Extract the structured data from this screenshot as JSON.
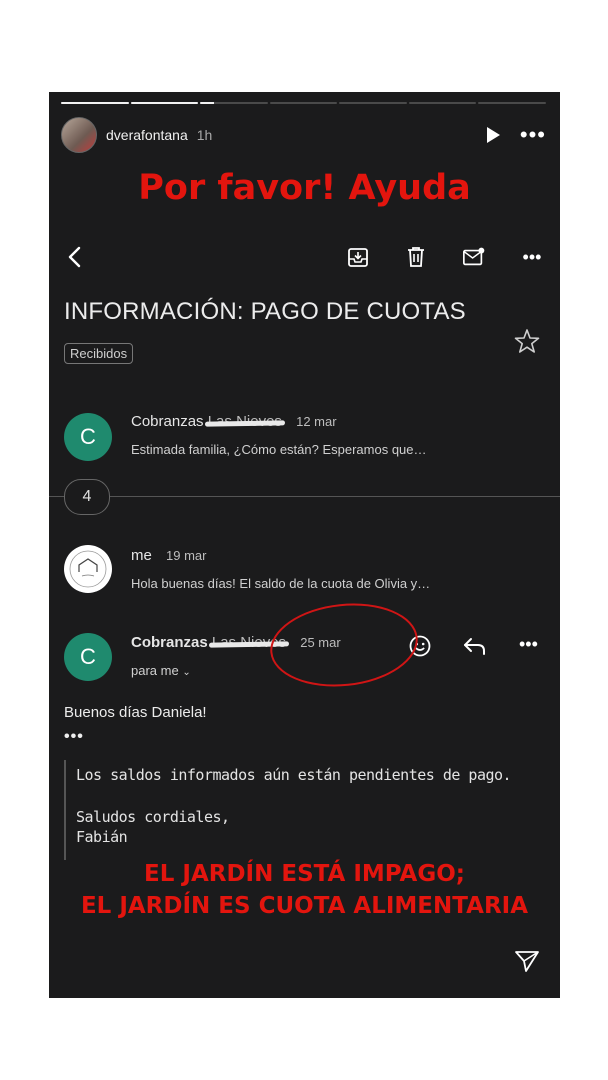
{
  "story": {
    "progress": [
      1.0,
      1.0,
      0.2,
      0,
      0,
      0,
      0
    ],
    "username": "dverafontana",
    "time": "1h",
    "overlay_title": "Por favor! Ayuda",
    "overlay_line1": "EL JARDÍN ESTÁ IMPAGO;",
    "overlay_line2": "EL JARDÍN ES CUOTA ALIMENTARIA"
  },
  "email": {
    "subject": "INFORMACIÓN: PAGO DE CUOTAS",
    "label": "Recibidos",
    "collapsed_count": "4",
    "messages": [
      {
        "avatar": "C",
        "sender": "Cobranzas",
        "scribbled": "Las Nieves",
        "date": "12 mar",
        "snippet": "Estimada familia, ¿Cómo están? Esperamos que…"
      },
      {
        "avatar": "",
        "sender": "me",
        "date": "19 mar",
        "snippet": "Hola buenas días! El saldo de la cuota de Olivia y…"
      },
      {
        "avatar": "C",
        "sender": "Cobranzas",
        "scribbled": "Las Nieves",
        "date": "25 mar",
        "recipient": "para me"
      }
    ],
    "greeting": "Buenos días Daniela!",
    "ellipsis": "•••",
    "quote_line1": "Los saldos informados aún están pendientes de pago.",
    "quote_line2": "Saludos cordiales,",
    "quote_line3": "Fabián"
  },
  "colors": {
    "accent_red": "#e3150e",
    "avatar_green": "#1f8a6e"
  }
}
